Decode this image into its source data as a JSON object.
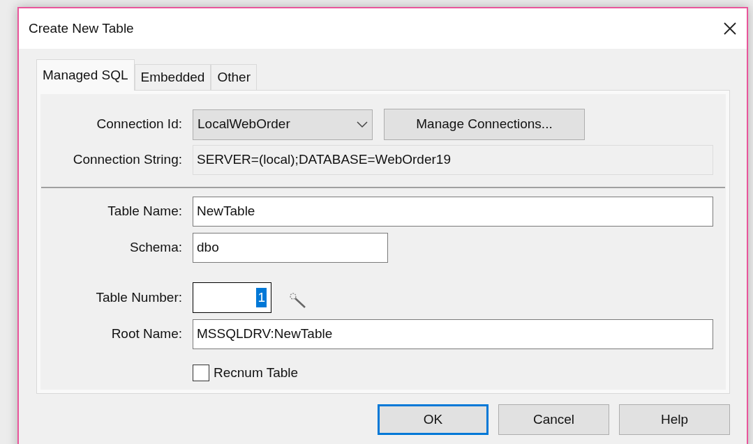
{
  "window": {
    "title": "Create New Table"
  },
  "tabs": [
    {
      "label": "Managed SQL",
      "selected": true
    },
    {
      "label": "Embedded",
      "selected": false
    },
    {
      "label": "Other",
      "selected": false
    }
  ],
  "connection_fields": [
    {
      "kind": "combo",
      "label": "Connection Id:",
      "value": "LocalWebOrder",
      "button": "Manage Connections..."
    },
    {
      "kind": "text",
      "label": "Connection String:",
      "value": "SERVER=(local);DATABASE=WebOrder19",
      "disabled": true
    }
  ],
  "table_fields": [
    {
      "kind": "text",
      "label": "Table Name:",
      "value": "NewTable",
      "disabled": false
    },
    {
      "kind": "short_text",
      "label": "Schema:",
      "value": "dbo",
      "disabled": false
    },
    {
      "kind": "number",
      "label": "Table Number:",
      "value": "1",
      "text_selected": true
    },
    {
      "kind": "text",
      "label": "Root Name:",
      "value": "MSSQLDRV:NewTable",
      "disabled": false
    },
    {
      "kind": "checkbox",
      "label": "Recnum Table",
      "checked": false
    }
  ],
  "buttons": [
    {
      "label": "OK",
      "default": true
    },
    {
      "label": "Cancel",
      "default": false
    },
    {
      "label": "Help",
      "default": false
    }
  ]
}
